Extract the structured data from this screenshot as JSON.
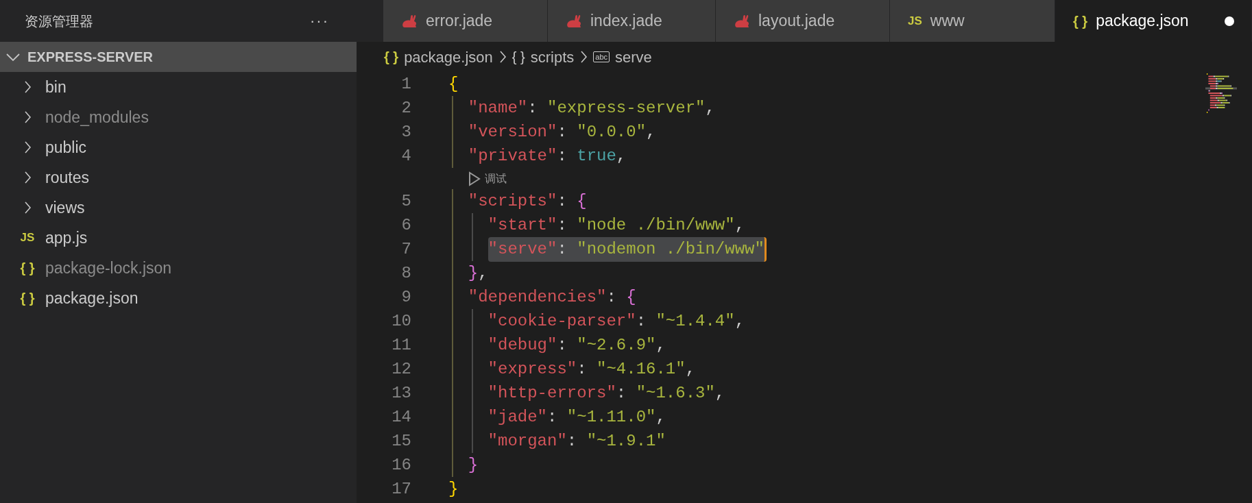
{
  "sidebar": {
    "title": "资源管理器",
    "more": "···",
    "root": {
      "label": "EXPRESS-SERVER",
      "expanded": true
    },
    "items": [
      {
        "kind": "folder",
        "label": "bin",
        "expanded": false,
        "dimmed": false
      },
      {
        "kind": "folder",
        "label": "node_modules",
        "expanded": false,
        "dimmed": true
      },
      {
        "kind": "folder",
        "label": "public",
        "expanded": false,
        "dimmed": false
      },
      {
        "kind": "folder",
        "label": "routes",
        "expanded": false,
        "dimmed": false
      },
      {
        "kind": "folder",
        "label": "views",
        "expanded": false,
        "dimmed": false
      },
      {
        "kind": "js",
        "icon_label": "JS",
        "label": "app.js",
        "dimmed": false
      },
      {
        "kind": "json",
        "icon_label": "{ }",
        "label": "package-lock.json",
        "dimmed": true
      },
      {
        "kind": "json",
        "icon_label": "{ }",
        "label": "package.json",
        "dimmed": false
      }
    ]
  },
  "tabs": [
    {
      "kind": "jade",
      "label": "error.jade",
      "selected": false,
      "modified": false
    },
    {
      "kind": "jade",
      "label": "index.jade",
      "selected": false,
      "modified": false
    },
    {
      "kind": "jade",
      "label": "layout.jade",
      "selected": false,
      "modified": false
    },
    {
      "kind": "js",
      "icon_label": "JS",
      "label": "www",
      "selected": false,
      "modified": false
    },
    {
      "kind": "json",
      "icon_label": "{ }",
      "label": "package.json",
      "selected": true,
      "modified": true
    }
  ],
  "breadcrumb": [
    {
      "kind": "json",
      "icon_label": "{ }",
      "label": "package.json"
    },
    {
      "kind": "object",
      "icon_label": "{ }",
      "label": "scripts"
    },
    {
      "kind": "string",
      "icon_label": "abc",
      "label": "serve"
    }
  ],
  "code": [
    {
      "kind": "line",
      "number": "1",
      "selected": false,
      "tokens": [
        {
          "kind": "brace1",
          "s": "{"
        }
      ],
      "children": [
        {
          "kind": "line",
          "number": "2",
          "selected": false,
          "tokens": [
            {
              "kind": "key",
              "s": "\"name\""
            },
            {
              "kind": "punct",
              "s": ": "
            },
            {
              "kind": "string",
              "s": "\"express-server\""
            },
            {
              "kind": "punct",
              "s": ","
            }
          ]
        },
        {
          "kind": "line",
          "number": "3",
          "selected": false,
          "tokens": [
            {
              "kind": "key",
              "s": "\"version\""
            },
            {
              "kind": "punct",
              "s": ": "
            },
            {
              "kind": "string",
              "s": "\"0.0.0\""
            },
            {
              "kind": "punct",
              "s": ","
            }
          ]
        },
        {
          "kind": "line",
          "number": "4",
          "selected": false,
          "tokens": [
            {
              "kind": "key",
              "s": "\"private\""
            },
            {
              "kind": "punct",
              "s": ": "
            },
            {
              "kind": "bool",
              "s": "true"
            },
            {
              "kind": "punct",
              "s": ","
            }
          ]
        },
        {
          "kind": "codelens",
          "label": "调试"
        },
        {
          "kind": "line",
          "number": "5",
          "selected": false,
          "tokens": [
            {
              "kind": "key",
              "s": "\"scripts\""
            },
            {
              "kind": "punct",
              "s": ": "
            },
            {
              "kind": "brace2",
              "s": "{"
            }
          ],
          "children": [
            {
              "kind": "line",
              "number": "6",
              "selected": false,
              "tokens": [
                {
                  "kind": "key",
                  "s": "\"start\""
                },
                {
                  "kind": "punct",
                  "s": ": "
                },
                {
                  "kind": "string",
                  "s": "\"node ./bin/www\""
                },
                {
                  "kind": "punct",
                  "s": ","
                }
              ]
            },
            {
              "kind": "line",
              "number": "7",
              "selected": true,
              "tokens": [
                {
                  "kind": "key",
                  "s": "\"serve\""
                },
                {
                  "kind": "punct",
                  "s": ": "
                },
                {
                  "kind": "string",
                  "s": "\"nodemon ./bin/www\""
                }
              ]
            }
          ]
        },
        {
          "kind": "line",
          "number": "8",
          "selected": false,
          "tokens": [
            {
              "kind": "brace2",
              "s": "}"
            },
            {
              "kind": "punct",
              "s": ","
            }
          ]
        },
        {
          "kind": "line",
          "number": "9",
          "selected": false,
          "tokens": [
            {
              "kind": "key",
              "s": "\"dependencies\""
            },
            {
              "kind": "punct",
              "s": ": "
            },
            {
              "kind": "brace2",
              "s": "{"
            }
          ],
          "children": [
            {
              "kind": "line",
              "number": "10",
              "selected": false,
              "tokens": [
                {
                  "kind": "key",
                  "s": "\"cookie-parser\""
                },
                {
                  "kind": "punct",
                  "s": ": "
                },
                {
                  "kind": "string",
                  "s": "\"~1.4.4\""
                },
                {
                  "kind": "punct",
                  "s": ","
                }
              ]
            },
            {
              "kind": "line",
              "number": "11",
              "selected": false,
              "tokens": [
                {
                  "kind": "key",
                  "s": "\"debug\""
                },
                {
                  "kind": "punct",
                  "s": ": "
                },
                {
                  "kind": "string",
                  "s": "\"~2.6.9\""
                },
                {
                  "kind": "punct",
                  "s": ","
                }
              ]
            },
            {
              "kind": "line",
              "number": "12",
              "selected": false,
              "tokens": [
                {
                  "kind": "key",
                  "s": "\"express\""
                },
                {
                  "kind": "punct",
                  "s": ": "
                },
                {
                  "kind": "string",
                  "s": "\"~4.16.1\""
                },
                {
                  "kind": "punct",
                  "s": ","
                }
              ]
            },
            {
              "kind": "line",
              "number": "13",
              "selected": false,
              "tokens": [
                {
                  "kind": "key",
                  "s": "\"http-errors\""
                },
                {
                  "kind": "punct",
                  "s": ": "
                },
                {
                  "kind": "string",
                  "s": "\"~1.6.3\""
                },
                {
                  "kind": "punct",
                  "s": ","
                }
              ]
            },
            {
              "kind": "line",
              "number": "14",
              "selected": false,
              "tokens": [
                {
                  "kind": "key",
                  "s": "\"jade\""
                },
                {
                  "kind": "punct",
                  "s": ": "
                },
                {
                  "kind": "string",
                  "s": "\"~1.11.0\""
                },
                {
                  "kind": "punct",
                  "s": ","
                }
              ]
            },
            {
              "kind": "line",
              "number": "15",
              "selected": false,
              "tokens": [
                {
                  "kind": "key",
                  "s": "\"morgan\""
                },
                {
                  "kind": "punct",
                  "s": ": "
                },
                {
                  "kind": "string",
                  "s": "\"~1.9.1\""
                }
              ]
            }
          ]
        },
        {
          "kind": "line",
          "number": "16",
          "selected": false,
          "tokens": [
            {
              "kind": "brace2",
              "s": "}"
            }
          ]
        }
      ]
    },
    {
      "kind": "line",
      "number": "17",
      "selected": false,
      "tokens": [
        {
          "kind": "brace1",
          "s": "}"
        }
      ]
    }
  ]
}
